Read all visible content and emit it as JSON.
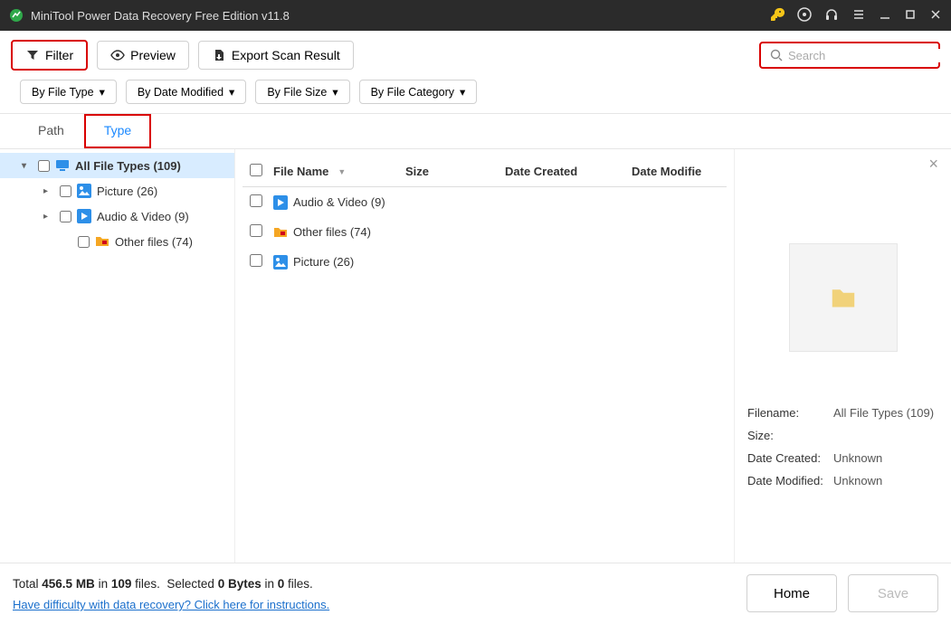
{
  "titlebar": {
    "title": "MiniTool Power Data Recovery Free Edition v11.8"
  },
  "toolbar": {
    "filter_label": "Filter",
    "preview_label": "Preview",
    "export_label": "Export Scan Result",
    "search_placeholder": "Search"
  },
  "filters": {
    "by_file_type": "By File Type",
    "by_date_modified": "By Date Modified",
    "by_file_size": "By File Size",
    "by_file_category": "By File Category"
  },
  "tabs": {
    "path": "Path",
    "type": "Type"
  },
  "tree": {
    "all": "All File Types (109)",
    "picture": "Picture (26)",
    "audio_video": "Audio & Video (9)",
    "other": "Other files (74)"
  },
  "columns": {
    "file_name": "File Name",
    "size": "Size",
    "date_created": "Date Created",
    "date_modified": "Date Modified",
    "date_modified_short": "Date Modifie"
  },
  "rows": {
    "audio_video": "Audio & Video (9)",
    "other": "Other files (74)",
    "picture": "Picture (26)"
  },
  "detail": {
    "filename_k": "Filename:",
    "filename_v": "All File Types (109)",
    "size_k": "Size:",
    "size_v": "",
    "date_created_k": "Date Created:",
    "date_created_v": "Unknown",
    "date_modified_k": "Date Modified:",
    "date_modified_v": "Unknown"
  },
  "status": {
    "total_prefix": "Total ",
    "total_size": "456.5 MB",
    "in": " in ",
    "file_count": "109",
    "files_suffix": " files. ",
    "selected_prefix": "Selected ",
    "selected_size": "0 Bytes",
    "in2": " in ",
    "selected_count": "0",
    "files_suffix2": " files.",
    "help_link": "Have difficulty with data recovery? Click here for instructions.",
    "home": "Home",
    "save": "Save"
  }
}
